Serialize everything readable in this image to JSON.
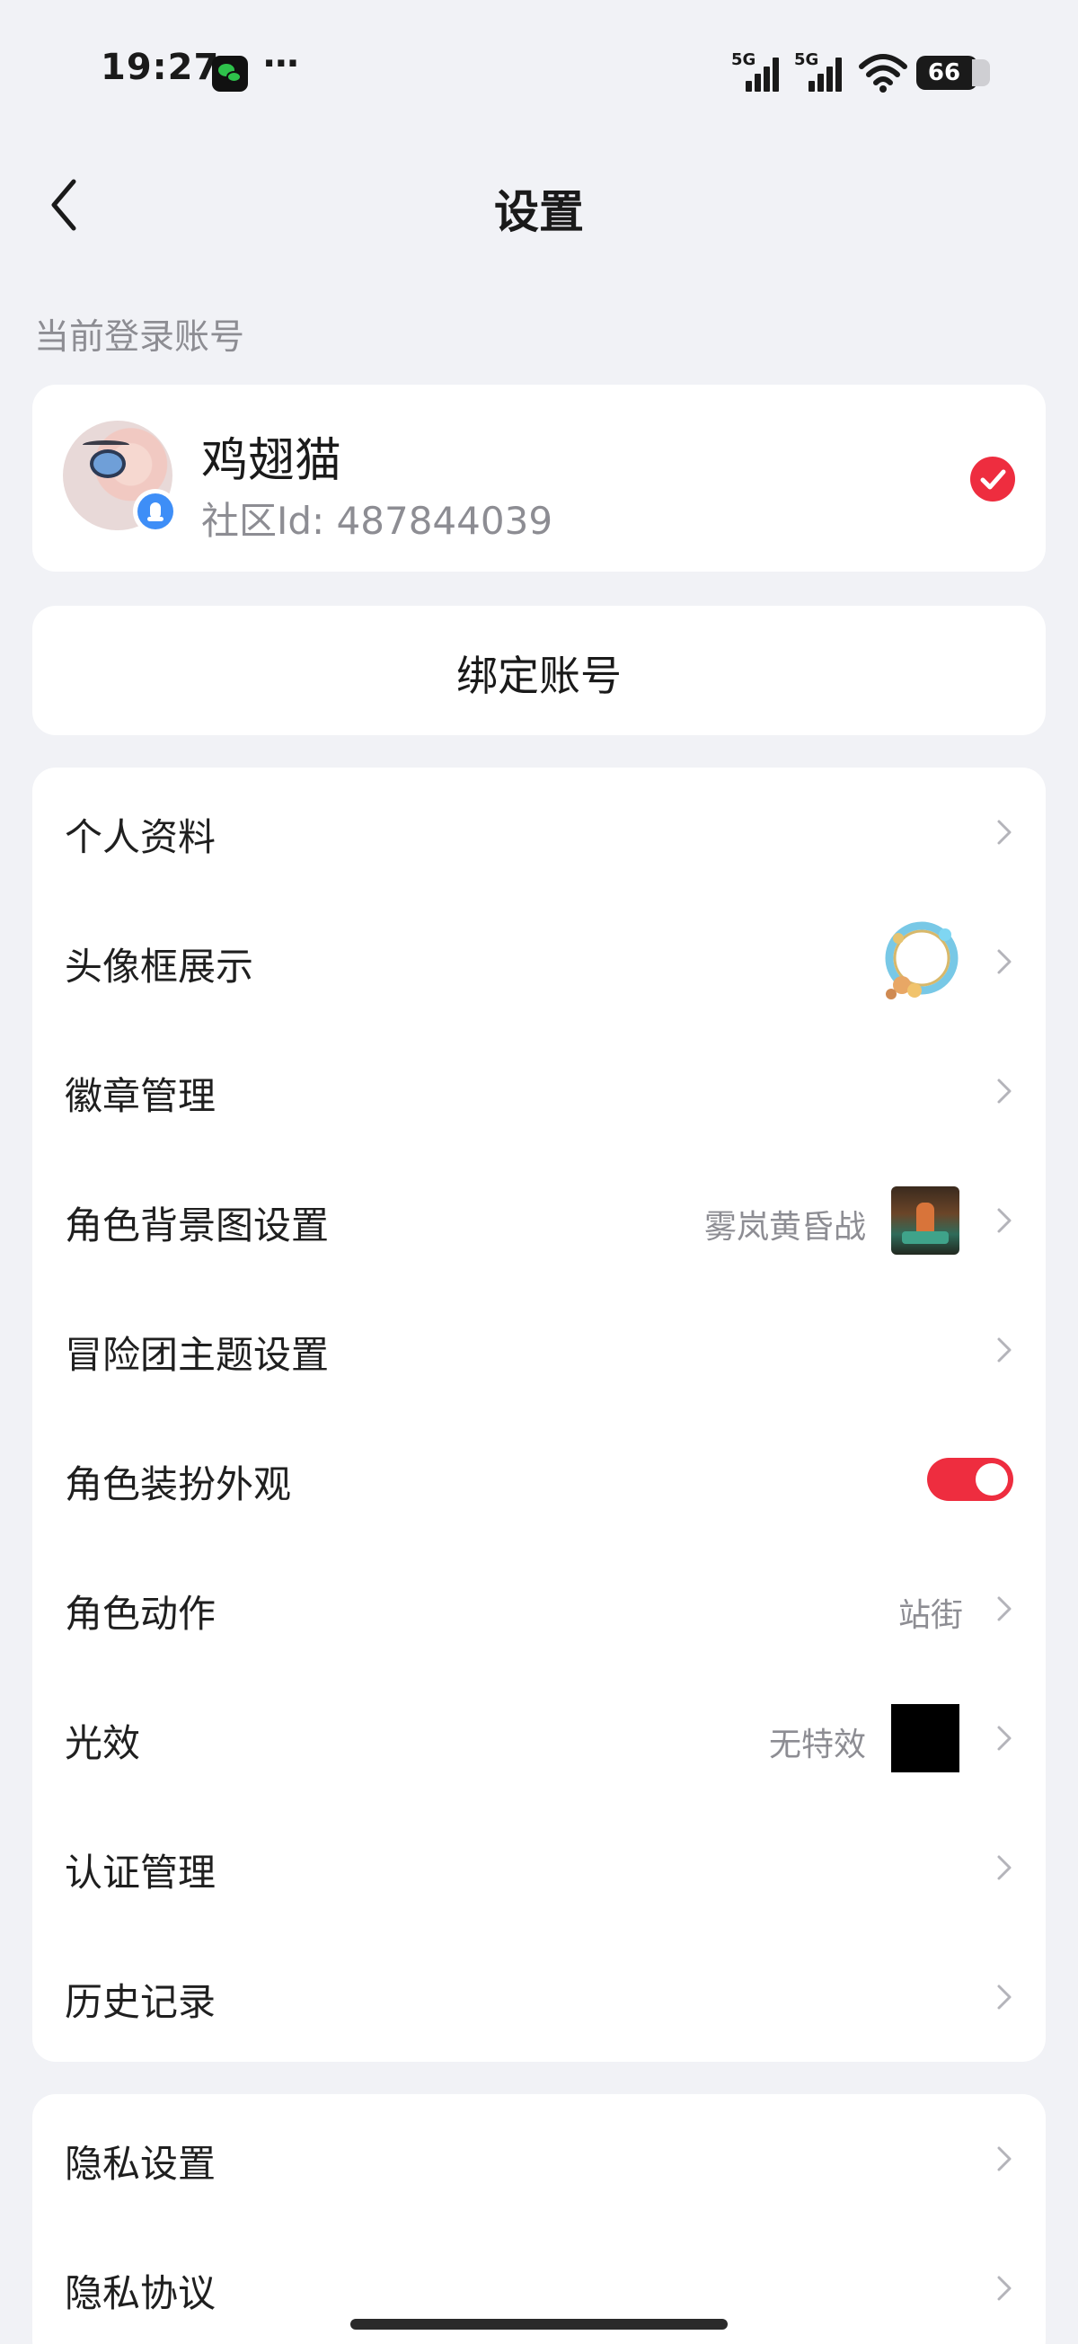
{
  "status_bar": {
    "time": "19:27",
    "more": "···",
    "signal_label": "5G",
    "battery": "66",
    "icons": [
      "wechat-icon",
      "more-icon",
      "signal-5g-icon",
      "wifi-icon",
      "battery-icon"
    ]
  },
  "header": {
    "title": "设置",
    "back_icon": "chevron-left-icon"
  },
  "account": {
    "section_label": "当前登录账号",
    "name": "鸡翅猫",
    "community_id": "社区Id: 487844039",
    "selected": true,
    "login_type_icon": "qq-icon"
  },
  "bind": {
    "label": "绑定账号"
  },
  "settings": {
    "items": [
      {
        "label": "个人资料",
        "value": ""
      },
      {
        "label": "头像框展示",
        "value": ""
      },
      {
        "label": "徽章管理",
        "value": ""
      },
      {
        "label": "角色背景图设置",
        "value": "雾岚黄昏战"
      },
      {
        "label": "冒险团主题设置",
        "value": ""
      },
      {
        "label": "角色装扮外观",
        "value": "",
        "toggle_on": true
      },
      {
        "label": "角色动作",
        "value": "站街"
      },
      {
        "label": "光效",
        "value": "无特效"
      },
      {
        "label": "认证管理",
        "value": ""
      },
      {
        "label": "历史记录",
        "value": ""
      }
    ]
  },
  "privacy": {
    "items": [
      {
        "label": "隐私设置"
      },
      {
        "label": "隐私协议"
      }
    ]
  },
  "colors": {
    "accent": "#ee2d3f",
    "background": "#f1f2f6",
    "card": "#ffffff",
    "secondary_text": "#8d8d93"
  }
}
